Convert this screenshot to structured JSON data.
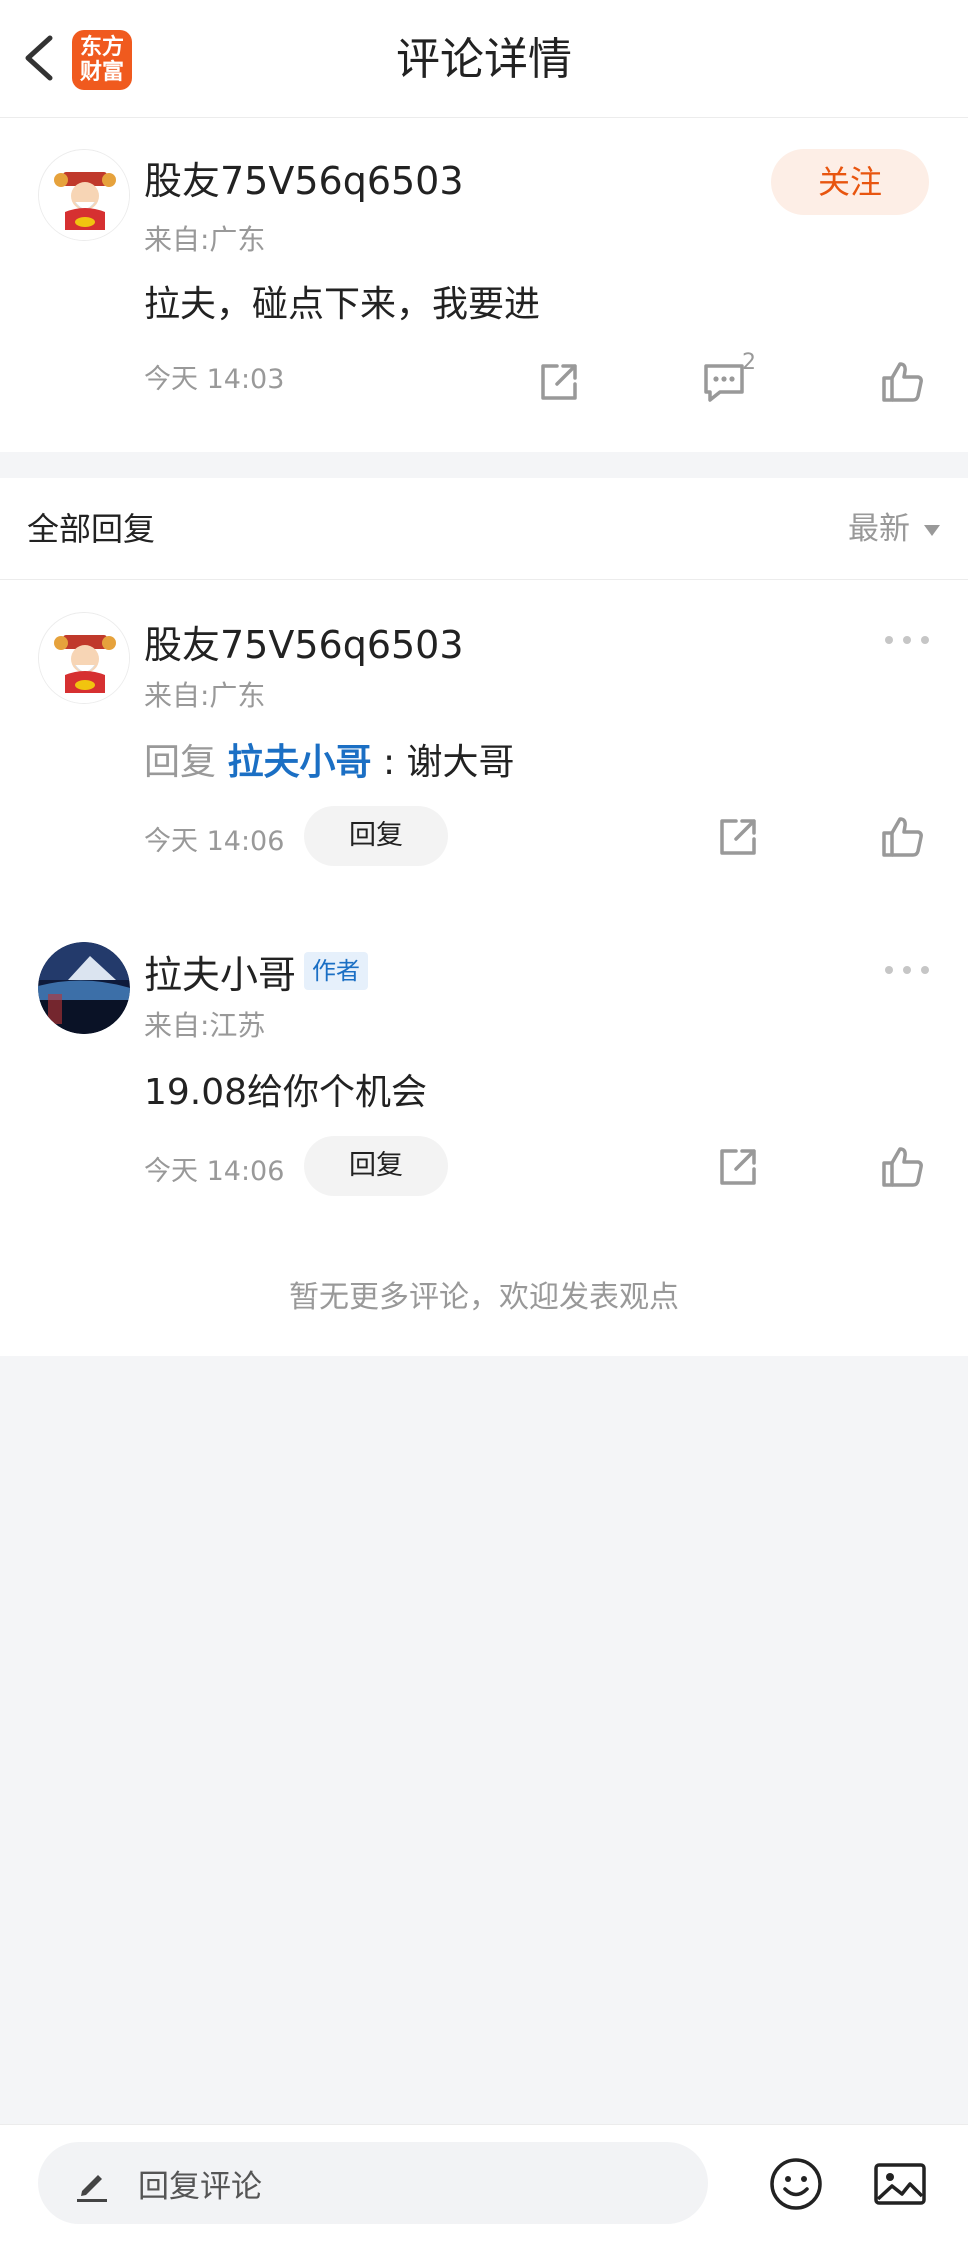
{
  "header": {
    "title": "评论详情",
    "logo_line1": "东方",
    "logo_line2": "财富"
  },
  "main_comment": {
    "username": "股友75V56q6503",
    "location": "来自:广东",
    "content": "拉夫，碰点下来，我要进",
    "time": "今天 14:03",
    "follow_label": "关注",
    "comment_count": "2"
  },
  "replies": {
    "title": "全部回复",
    "sort_label": "最新",
    "items": [
      {
        "username": "股友75V56q6503",
        "location": "来自:广东",
        "reply_prefix": "回复",
        "mention": "拉夫小哥",
        "separator": ":",
        "content": " 谢大哥",
        "time": "今天 14:06",
        "reply_label": "回复"
      },
      {
        "username": "拉夫小哥",
        "author_tag": "作者",
        "location": "来自:江苏",
        "content": "19.08给你个机会",
        "time": "今天 14:06",
        "reply_label": "回复"
      }
    ],
    "no_more_text": "暂无更多评论，欢迎发表观点"
  },
  "bottom_bar": {
    "placeholder": "回复评论"
  },
  "colors": {
    "brand_orange": "#f05a1e",
    "follow_text": "#e8550f",
    "follow_bg": "#fdeee6",
    "mention_blue": "#1b6fc4",
    "page_bg": "#f4f5f7"
  },
  "icons": [
    "back-icon",
    "app-logo",
    "share-icon",
    "comment-icon",
    "thumbs-up-icon",
    "more-icon",
    "sort-caret-icon",
    "pencil-icon",
    "emoji-icon",
    "image-icon"
  ]
}
